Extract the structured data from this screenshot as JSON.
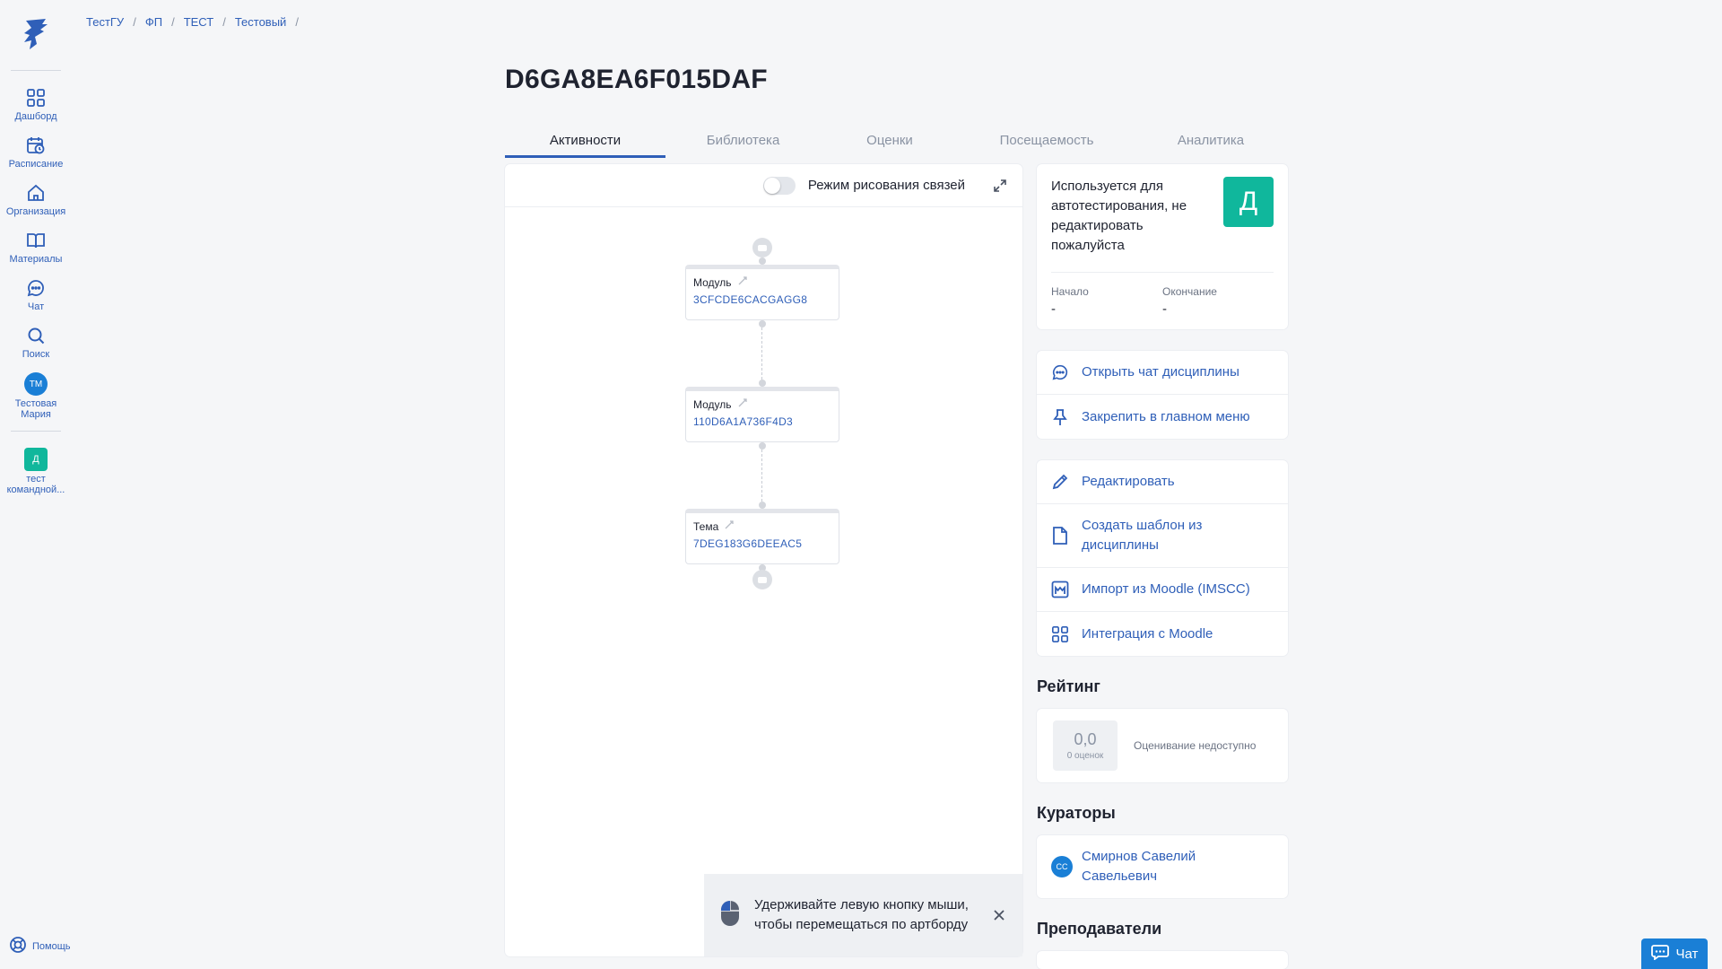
{
  "sidebar": {
    "items": [
      {
        "label": "Дашборд",
        "icon": "dashboard-icon"
      },
      {
        "label": "Расписание",
        "icon": "calendar-icon"
      },
      {
        "label": "Организация",
        "icon": "organization-icon"
      },
      {
        "label": "Материалы",
        "icon": "book-icon"
      },
      {
        "label": "Чат",
        "icon": "chat-icon"
      },
      {
        "label": "Поиск",
        "icon": "search-icon"
      }
    ],
    "user": {
      "initials": "ТМ",
      "name": "Тестовая Мария"
    },
    "team": {
      "initials": "Д",
      "name": "тест командной..."
    },
    "help": "Помощь"
  },
  "breadcrumb": [
    "ТестГУ",
    "ФП",
    "ТЕСТ",
    "Тестовый"
  ],
  "page": {
    "title": "D6GA8EA6F015DAF"
  },
  "tabs": [
    "Активности",
    "Библиотека",
    "Оценки",
    "Посещаемость",
    "Аналитика"
  ],
  "canvas": {
    "toggle_label": "Режим рисования связей",
    "toggle_on": false,
    "nodes": [
      {
        "type": "Модуль",
        "code": "3CFCDE6CACGAGG8"
      },
      {
        "type": "Модуль",
        "code": "110D6A1A736F4D3"
      },
      {
        "type": "Тема",
        "code": "7DEG183G6DEEAC5"
      }
    ],
    "toast": "Удерживайте левую кнопку мыши, чтобы перемещаться по артборду"
  },
  "info": {
    "description": "Используется для автотестирования, не редактировать пожалуйста",
    "badge": "Д",
    "badge_color": "#10b79c",
    "start_label": "Начало",
    "start_value": "-",
    "end_label": "Окончание",
    "end_value": "-"
  },
  "quick_actions": [
    {
      "label": "Открыть чат дисциплины",
      "icon": "chat-icon"
    },
    {
      "label": "Закрепить в главном меню",
      "icon": "pin-icon"
    }
  ],
  "edit_actions": [
    {
      "label": "Редактировать",
      "icon": "pencil-icon"
    },
    {
      "label": "Создать шаблон из дисциплины",
      "icon": "document-icon"
    },
    {
      "label": "Импорт из Moodle (IMSCC)",
      "icon": "moodle-icon"
    },
    {
      "label": "Интеграция с Moodle",
      "icon": "grid-icon"
    }
  ],
  "rating": {
    "title": "Рейтинг",
    "value": "0,0",
    "count": "0 оценок",
    "note": "Оценивание недоступно"
  },
  "curators": {
    "title": "Кураторы",
    "items": [
      {
        "initials": "СС",
        "name": "Смирнов Савелий Савельевич"
      }
    ]
  },
  "teachers": {
    "title": "Преподаватели"
  },
  "chat_button": "Чат",
  "colors": {
    "accent": "#2f5fb8",
    "avatar": "#1a7fd6",
    "teal": "#10b79c"
  }
}
